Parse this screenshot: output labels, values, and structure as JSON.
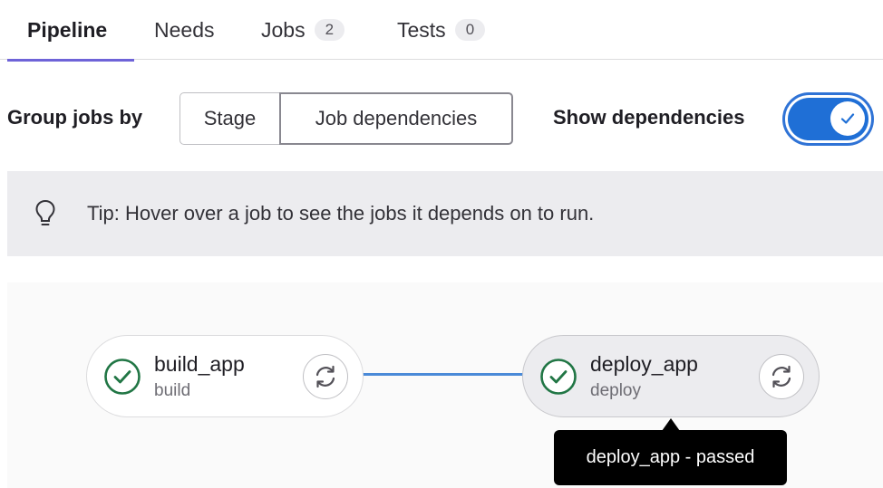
{
  "tabs": [
    {
      "label": "Pipeline",
      "active": true
    },
    {
      "label": "Needs"
    },
    {
      "label": "Jobs",
      "count": "2"
    },
    {
      "label": "Tests",
      "count": "0"
    }
  ],
  "controls": {
    "group_label": "Group jobs by",
    "stage_option": "Stage",
    "deps_option": "Job dependencies",
    "selected": "Job dependencies",
    "show_deps_label": "Show dependencies",
    "show_deps_enabled": true
  },
  "tip": {
    "icon": "lightbulb-icon",
    "text": "Tip: Hover over a job to see the jobs it depends on to run."
  },
  "jobs": [
    {
      "name": "build_app",
      "stage": "build",
      "status": "passed",
      "icon": "status-success-icon",
      "action_icon": "retry-icon"
    },
    {
      "name": "deploy_app",
      "stage": "deploy",
      "status": "passed",
      "icon": "status-success-icon",
      "action_icon": "retry-icon"
    }
  ],
  "tooltip": {
    "text": "deploy_app - passed"
  },
  "colors": {
    "tab_underline": "#6e63d8",
    "toggle": "#1f6fd6",
    "connector": "#4a8ad8",
    "success": "#217645"
  }
}
